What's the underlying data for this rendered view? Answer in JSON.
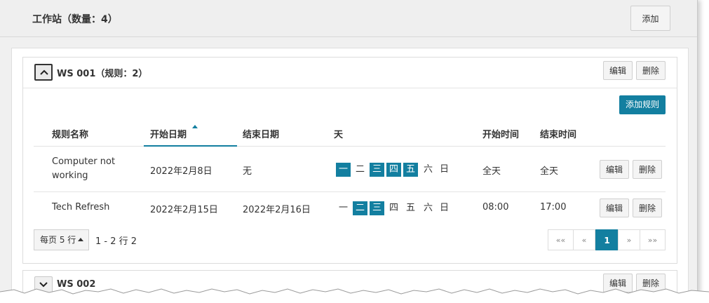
{
  "header": {
    "title": "工作站（数量：4）",
    "add_label": "添加"
  },
  "workstations": [
    {
      "title": "WS 001（规则：2）",
      "edit_label": "编辑",
      "delete_label": "删除",
      "add_rule_label": "添加规则",
      "columns": [
        "规则名称",
        "开始日期",
        "结束日期",
        "天",
        "开始时间",
        "结束时间"
      ],
      "sort_column": "开始日期",
      "rows": [
        {
          "name_line1": "Computer not",
          "name_line2": "working",
          "start_date": "2022年2月8日",
          "end_date": "无",
          "days": [
            {
              "label": "一",
              "on": true
            },
            {
              "label": "二",
              "on": false
            },
            {
              "label": "三",
              "on": true
            },
            {
              "label": "四",
              "on": true
            },
            {
              "label": "五",
              "on": true
            },
            {
              "label": "六",
              "on": false
            },
            {
              "label": "日",
              "on": false
            }
          ],
          "start_time": "全天",
          "end_time": "全天",
          "edit_label": "编辑",
          "delete_label": "删除"
        },
        {
          "name_line1": "Tech Refresh",
          "name_line2": "",
          "start_date": "2022年2月15日",
          "end_date": "2022年2月16日",
          "days": [
            {
              "label": "一",
              "on": false
            },
            {
              "label": "二",
              "on": true
            },
            {
              "label": "三",
              "on": true
            },
            {
              "label": "四",
              "on": false
            },
            {
              "label": "五",
              "on": false
            },
            {
              "label": "六",
              "on": false
            },
            {
              "label": "日",
              "on": false
            }
          ],
          "start_time": "08:00",
          "end_time": "17:00",
          "edit_label": "编辑",
          "delete_label": "删除"
        }
      ],
      "rows_per_page_label": "每页 5 行",
      "range_text": "1 - 2 行 2",
      "pager": {
        "first": "««",
        "prev": "«",
        "current": "1",
        "next": "»",
        "last": "»»"
      }
    },
    {
      "title": "WS 002",
      "edit_label": "编辑",
      "delete_label": "删除"
    }
  ],
  "colors": {
    "accent": "#137fa0"
  },
  "icons": {
    "expanded": "chevron-up-icon",
    "collapsed": "chevron-down-icon",
    "sort": "sort-ascending-icon"
  }
}
